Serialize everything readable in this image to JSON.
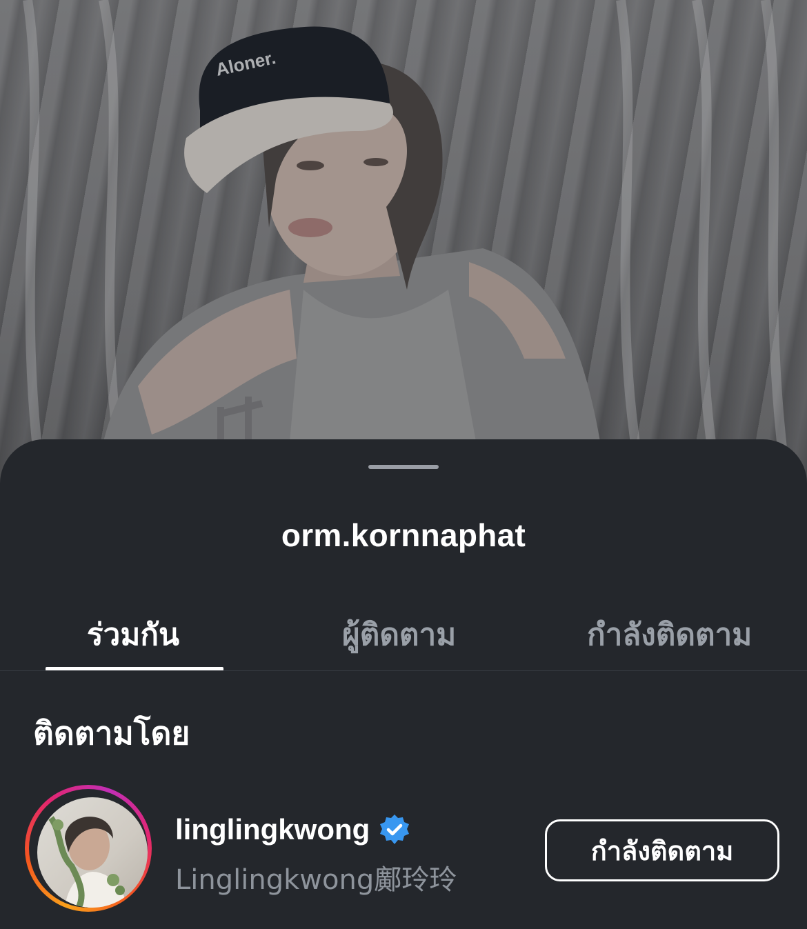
{
  "profile": {
    "username": "orm.kornnaphat"
  },
  "tabs": [
    {
      "label": "ร่วมกัน",
      "active": true
    },
    {
      "label": "ผู้ติดตาม",
      "active": false
    },
    {
      "label": "กำลังติดตาม",
      "active": false
    }
  ],
  "section": {
    "heading": "ติดตามโดย"
  },
  "list": [
    {
      "username": "linglingkwong",
      "verified": true,
      "full_name": "Linglingkwong鄺玲玲",
      "button_label": "กำลังติดตาม",
      "avatar": "user-avatar-photo"
    }
  ],
  "photo": {
    "cap_text": "Aloner."
  },
  "colors": {
    "sheet_bg": "#24272c",
    "text_primary": "#ffffff",
    "text_secondary": "#9aa0a8",
    "verified_blue": "#3897f0"
  },
  "icons": {
    "verified": "verified-badge-icon"
  }
}
